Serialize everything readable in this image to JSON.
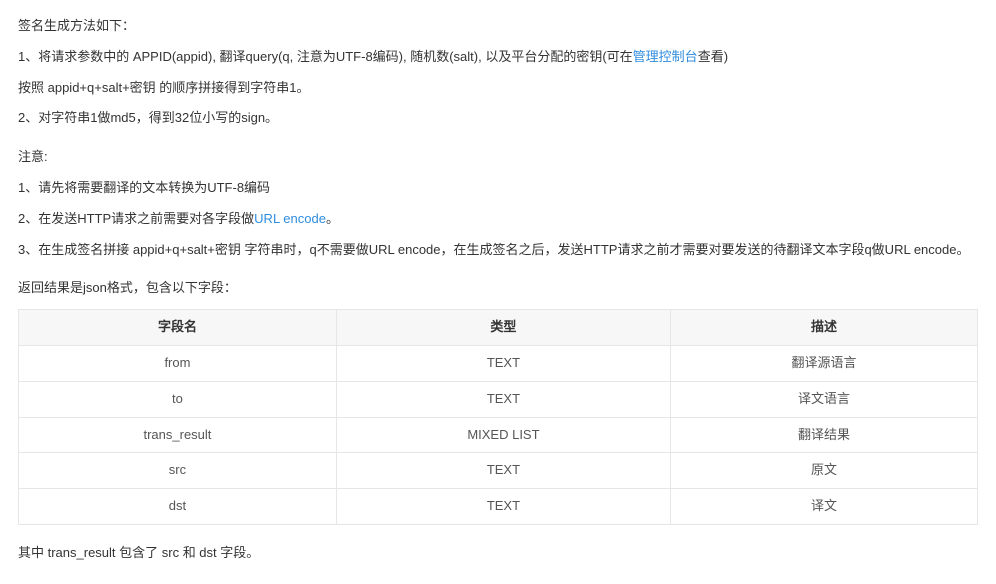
{
  "sig_heading": "签名生成方法如下：",
  "sig_line1_a": "1、将请求参数中的 APPID(appid), 翻译query(q, 注意为UTF-8编码), 随机数(salt), 以及平台分配的密钥(可在",
  "sig_line1_link": "管理控制台",
  "sig_line1_b": "查看)",
  "sig_line2": "按照 appid+q+salt+密钥 的顺序拼接得到字符串1。",
  "sig_line3": "2、对字符串1做md5，得到32位小写的sign。",
  "note_heading": "注意:",
  "note_line1": "1、请先将需要翻译的文本转换为UTF-8编码",
  "note_line2_a": "2、在发送HTTP请求之前需要对各字段做",
  "note_line2_link": "URL encode",
  "note_line2_b": "。",
  "note_line3": "3、在生成签名拼接 appid+q+salt+密钥 字符串时，q不需要做URL encode，在生成签名之后，发送HTTP请求之前才需要对要发送的待翻译文本字段q做URL encode。",
  "result_heading": "返回结果是json格式，包含以下字段：",
  "table": {
    "headers": {
      "c0": "字段名",
      "c1": "类型",
      "c2": "描述"
    },
    "rows": [
      {
        "c0": "from",
        "c1": "TEXT",
        "c2": "翻译源语言"
      },
      {
        "c0": "to",
        "c1": "TEXT",
        "c2": "译文语言"
      },
      {
        "c0": "trans_result",
        "c1": "MIXED LIST",
        "c2": "翻译结果"
      },
      {
        "c0": "src",
        "c1": "TEXT",
        "c2": "原文"
      },
      {
        "c0": "dst",
        "c1": "TEXT",
        "c2": "译文"
      }
    ]
  },
  "footer": "其中 trans_result 包含了 src 和 dst 字段。"
}
